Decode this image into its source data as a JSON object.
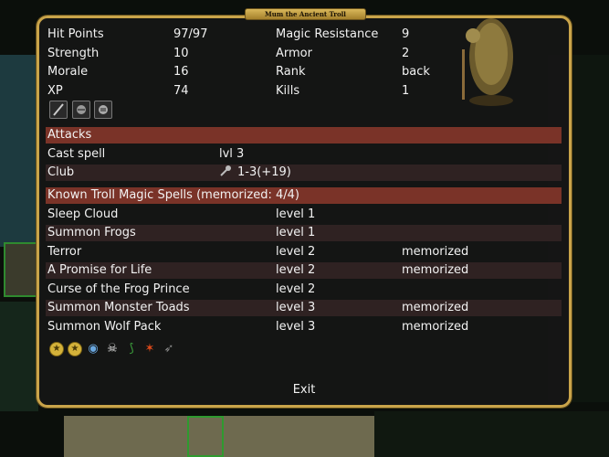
{
  "window": {
    "title": "Mum the Ancient Troll"
  },
  "stats": {
    "left": [
      {
        "label": "Hit Points",
        "value": "97/97"
      },
      {
        "label": "Strength",
        "value": "10"
      },
      {
        "label": "Morale",
        "value": "16"
      },
      {
        "label": "XP",
        "value": "74"
      }
    ],
    "right": [
      {
        "label": "Magic Resistance",
        "value": "9"
      },
      {
        "label": "Armor",
        "value": "2"
      },
      {
        "label": "Rank",
        "value": "back"
      },
      {
        "label": "Kills",
        "value": "1"
      }
    ]
  },
  "equipment": [
    "staff-icon",
    "helmet-icon",
    "armor-icon"
  ],
  "attacks": {
    "header": "Attacks",
    "rows": [
      {
        "name": "Cast spell",
        "value": "lvl 3"
      },
      {
        "name": "Club",
        "value": "1-3(+19)"
      }
    ]
  },
  "spells": {
    "header": "Known Troll Magic Spells (memorized: 4/4)",
    "rows": [
      {
        "name": "Sleep Cloud",
        "level": "level 1",
        "status": ""
      },
      {
        "name": "Summon Frogs",
        "level": "level 1",
        "status": ""
      },
      {
        "name": "Terror",
        "level": "level 2",
        "status": "memorized"
      },
      {
        "name": "A Promise for Life",
        "level": "level 2",
        "status": "memorized"
      },
      {
        "name": "Curse of the Frog Prince",
        "level": "level 2",
        "status": ""
      },
      {
        "name": "Summon Monster Toads",
        "level": "level 3",
        "status": "memorized"
      },
      {
        "name": "Summon Wolf Pack",
        "level": "level 3",
        "status": "memorized"
      }
    ]
  },
  "effects": [
    "star-icon",
    "star-icon",
    "eye-icon",
    "skull-icon",
    "claw-icon",
    "fire-icon",
    "bird-icon"
  ],
  "buttons": {
    "exit": "Exit"
  },
  "colors": {
    "border": "#c9a44a",
    "header_band": "#7a3328",
    "row_band": "#2f2222"
  }
}
